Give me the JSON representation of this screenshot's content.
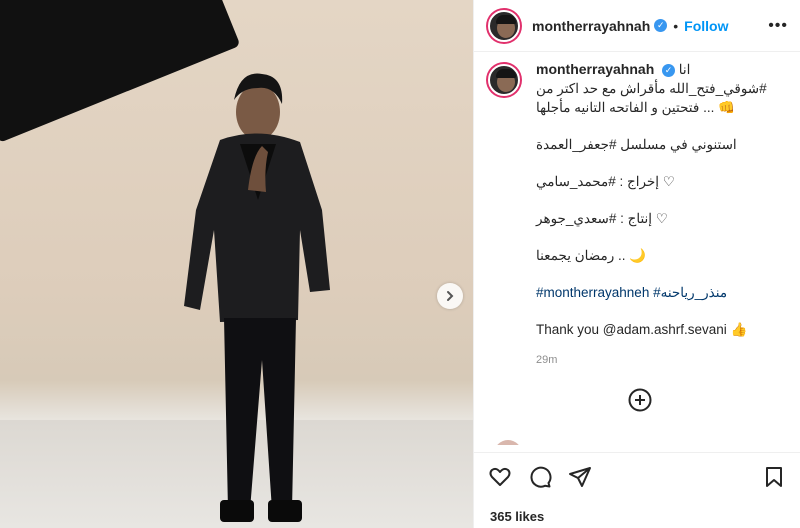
{
  "post": {
    "username": "montherrayahnah",
    "follow_label": "Follow",
    "more_label": "•••",
    "separator": "•"
  },
  "caption": {
    "username": "montherrayahnah",
    "lines": [
      {
        "text": "انا #شوقي_فتح_الله مأقراش مع حد اكتر من فتحتين و الفاتحه التانيه مأجلها ... 👊",
        "type": "mixed"
      },
      {
        "text": "استنوني في مسلسل #جعفر_العمدة",
        "type": "mixed"
      },
      {
        "text": "♡ إخراج : #محمد_سامي",
        "type": "mixed"
      },
      {
        "text": "♡ إنتاج : #سعدي_جوهر",
        "type": "mixed"
      },
      {
        "text": "🌙 .. رمضان يجمعنا",
        "type": "plain"
      },
      {
        "text": "#montherrayahneh #منذر_رياحنه",
        "type": "tag"
      },
      {
        "text": "Thank you @adam.ashrf.sevani 👍",
        "type": "mixed"
      }
    ],
    "time": "29m"
  },
  "actions": {
    "like_icon": "heart-icon",
    "comment_icon": "comment-icon",
    "share_icon": "share-icon",
    "save_icon": "bookmark-icon"
  },
  "likes": "365 likes",
  "colors": {
    "accent": "#0095f6",
    "link": "#00376b",
    "ring": "#e1306c",
    "verified": "#3897f0"
  }
}
